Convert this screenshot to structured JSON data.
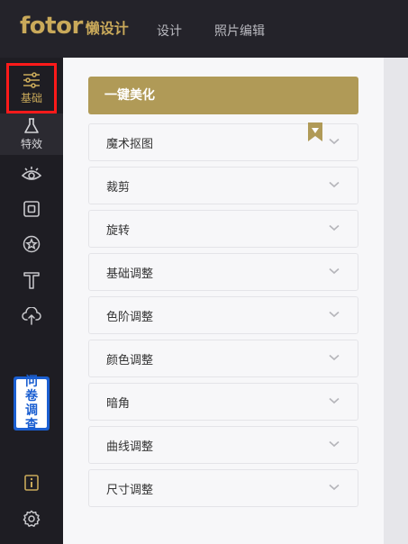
{
  "header": {
    "logo_text": "fotor",
    "logo_subtext": "懒设计",
    "nav": [
      "设计",
      "照片编辑"
    ]
  },
  "sidebar": {
    "items": [
      {
        "label": "基础",
        "icon": "sliders-icon",
        "selected": true
      },
      {
        "label": "特效",
        "icon": "flask-icon"
      },
      {
        "icon": "eye-icon"
      },
      {
        "icon": "frame-icon"
      },
      {
        "icon": "star-circle-icon"
      },
      {
        "icon": "text-icon"
      },
      {
        "icon": "cloud-upload-icon"
      }
    ],
    "survey_chars": [
      "问",
      "卷",
      "调",
      "查"
    ],
    "bottom_icons": [
      "info-icon",
      "gear-icon"
    ]
  },
  "panel": {
    "one_click_label": "一键美化",
    "rows": [
      "魔术抠图",
      "裁剪",
      "旋转",
      "基础调整",
      "色阶调整",
      "颜色调整",
      "暗角",
      "曲线调整",
      "尺寸调整"
    ]
  },
  "colors": {
    "topbar": "#24232a",
    "sidebar": "#1e1d23",
    "gold": "#c9a95a",
    "one_click_bg": "#b09a57",
    "survey_blue": "#1b5fd1",
    "highlight_red": "#ff1a1a"
  }
}
